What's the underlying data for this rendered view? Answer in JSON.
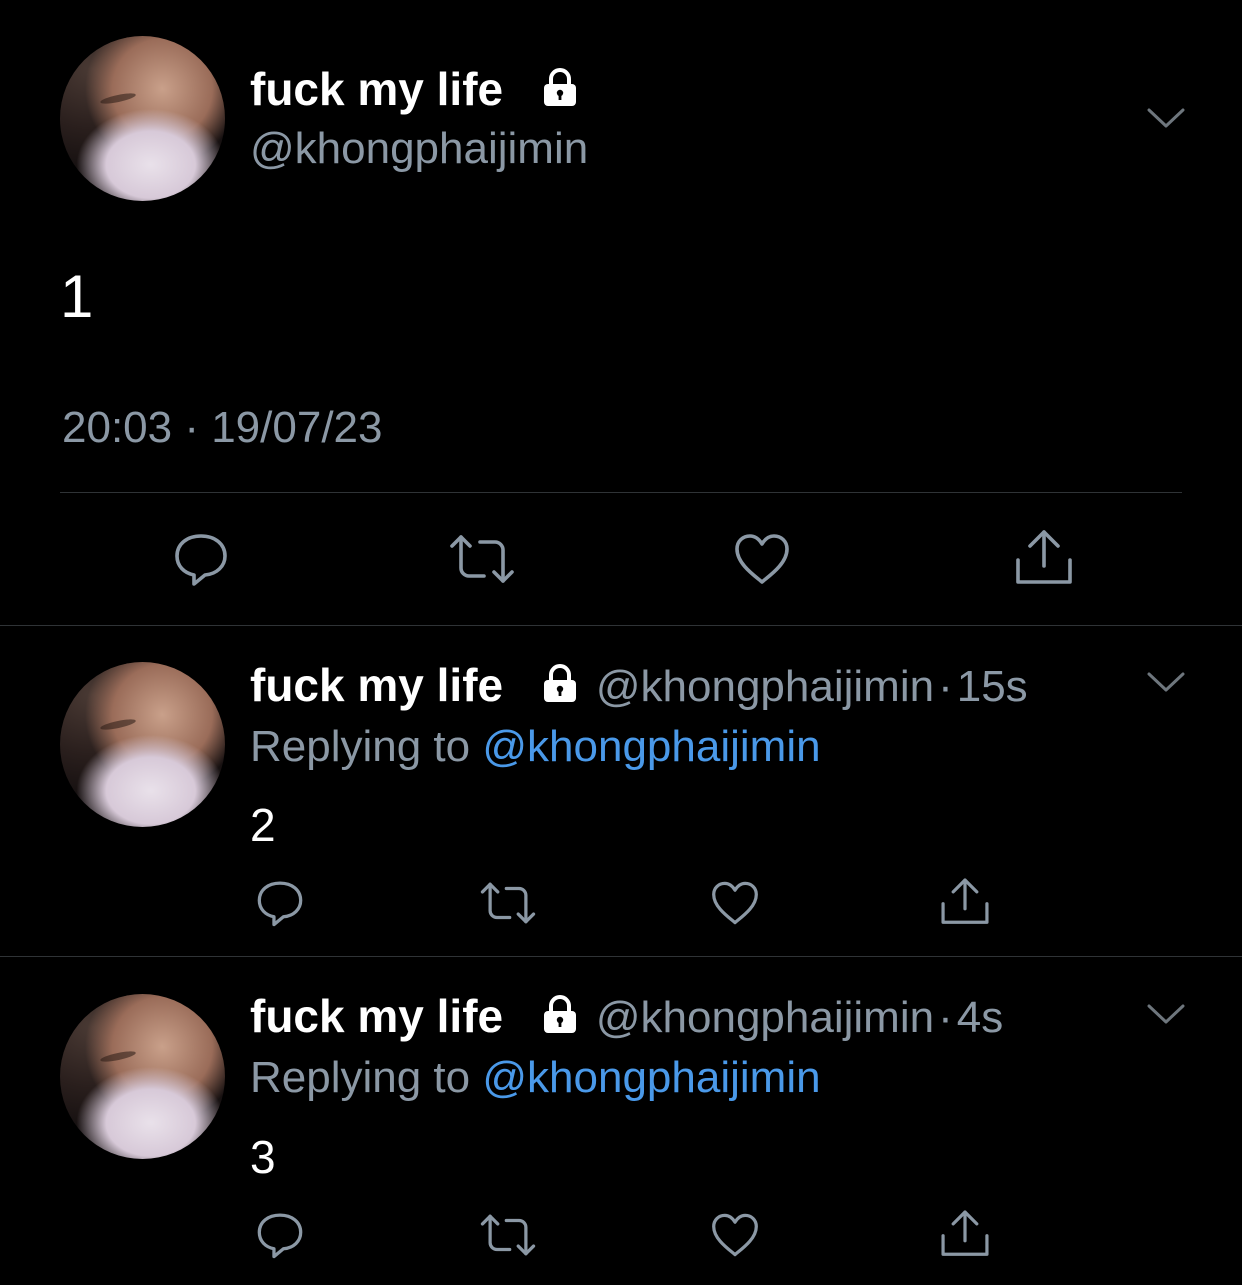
{
  "main_tweet": {
    "display_name": "fuck my life",
    "handle": "@khongphaijimin",
    "text": "1",
    "timestamp": "20:03 · 19/07/23",
    "icons": {
      "lock": "lock-icon",
      "menu": "chevron-down-icon"
    },
    "actions": [
      "reply-icon",
      "retweet-icon",
      "like-icon",
      "share-icon"
    ]
  },
  "replies": [
    {
      "display_name": "fuck my life",
      "handle": "@khongphaijimin",
      "separator": "·",
      "time": "15s",
      "replying_label": "Replying to",
      "replying_to": "@khongphaijimin",
      "text": "2"
    },
    {
      "display_name": "fuck my life",
      "handle": "@khongphaijimin",
      "separator": "·",
      "time": "4s",
      "replying_label": "Replying to",
      "replying_to": "@khongphaijimin",
      "text": "3"
    }
  ],
  "colors": {
    "background": "#000000",
    "secondary_text": "#8b98a5",
    "mention": "#4a99e9",
    "divider": "#2f3336"
  }
}
